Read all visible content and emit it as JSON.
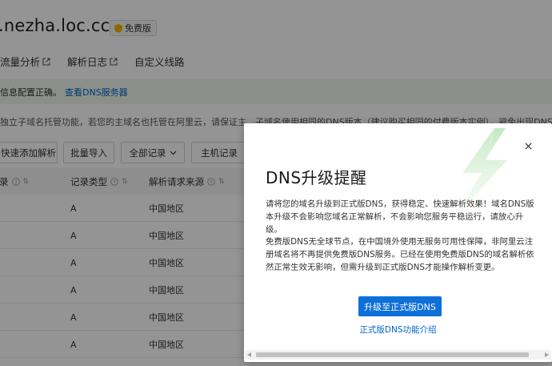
{
  "page": {
    "domain": ".nezha.loc.cc",
    "plan_badge": "免费版",
    "tabs": [
      {
        "label": "流量分析",
        "external": true
      },
      {
        "label": "解析日志",
        "external": true
      },
      {
        "label": "自定义线路",
        "external": false
      }
    ],
    "info_bar": {
      "text": "信息配置正确。",
      "link": "查看DNS服务器"
    },
    "warning_text": "独立子域名托管功能，若您的主域名也托管在阿里云，请保证主、子域名使用相同的DNS版本（建议购买相同的付费版本实例），避免出现DNS解析异常故障。更多",
    "toolbar": {
      "quick_add": "快速添加解析",
      "batch_import": "批量导入",
      "all_records": "全部记录",
      "host_record": "主机记录"
    },
    "table": {
      "headers": [
        "录",
        "记录类型",
        "解析请求来源"
      ],
      "rows": [
        {
          "type": "A",
          "source": "中国地区"
        },
        {
          "type": "A",
          "source": "中国地区"
        },
        {
          "type": "A",
          "source": "中国地区"
        },
        {
          "type": "A",
          "source": "中国地区"
        },
        {
          "type": "A",
          "source": "中国地区"
        },
        {
          "type": "A",
          "source": "中国地区"
        }
      ]
    }
  },
  "modal": {
    "title": "DNS升级提醒",
    "paragraph1": "请将您的域名升级到正式版DNS，获得稳定、快速解析效果！域名DNS版本升级不会影响您域名正常解析，不会影响您服务平稳运行，请放心升级。",
    "paragraph2": "免费版DNS无全球节点，在中国境外使用无服务可用性保障，非阿里云注册域名将不再提供免费版DNS服务。已经在使用免费版DNS的域名解析依然正常生效无影响，但需升级到正式版DNS才能操作解析变更。",
    "primary_button": "升级至正式版DNS",
    "intro_link": "正式版DNS功能介绍"
  },
  "colors": {
    "primary": "#0d6fd8",
    "link": "#0064c8",
    "info_bar_bg": "#eef6ee",
    "overlay": "rgba(0,0,0,0.42)"
  },
  "icons": [
    "shield-icon",
    "external-link-icon",
    "chevron-down-icon",
    "help-icon",
    "sort-icon",
    "close-icon",
    "lightning-icon"
  ]
}
